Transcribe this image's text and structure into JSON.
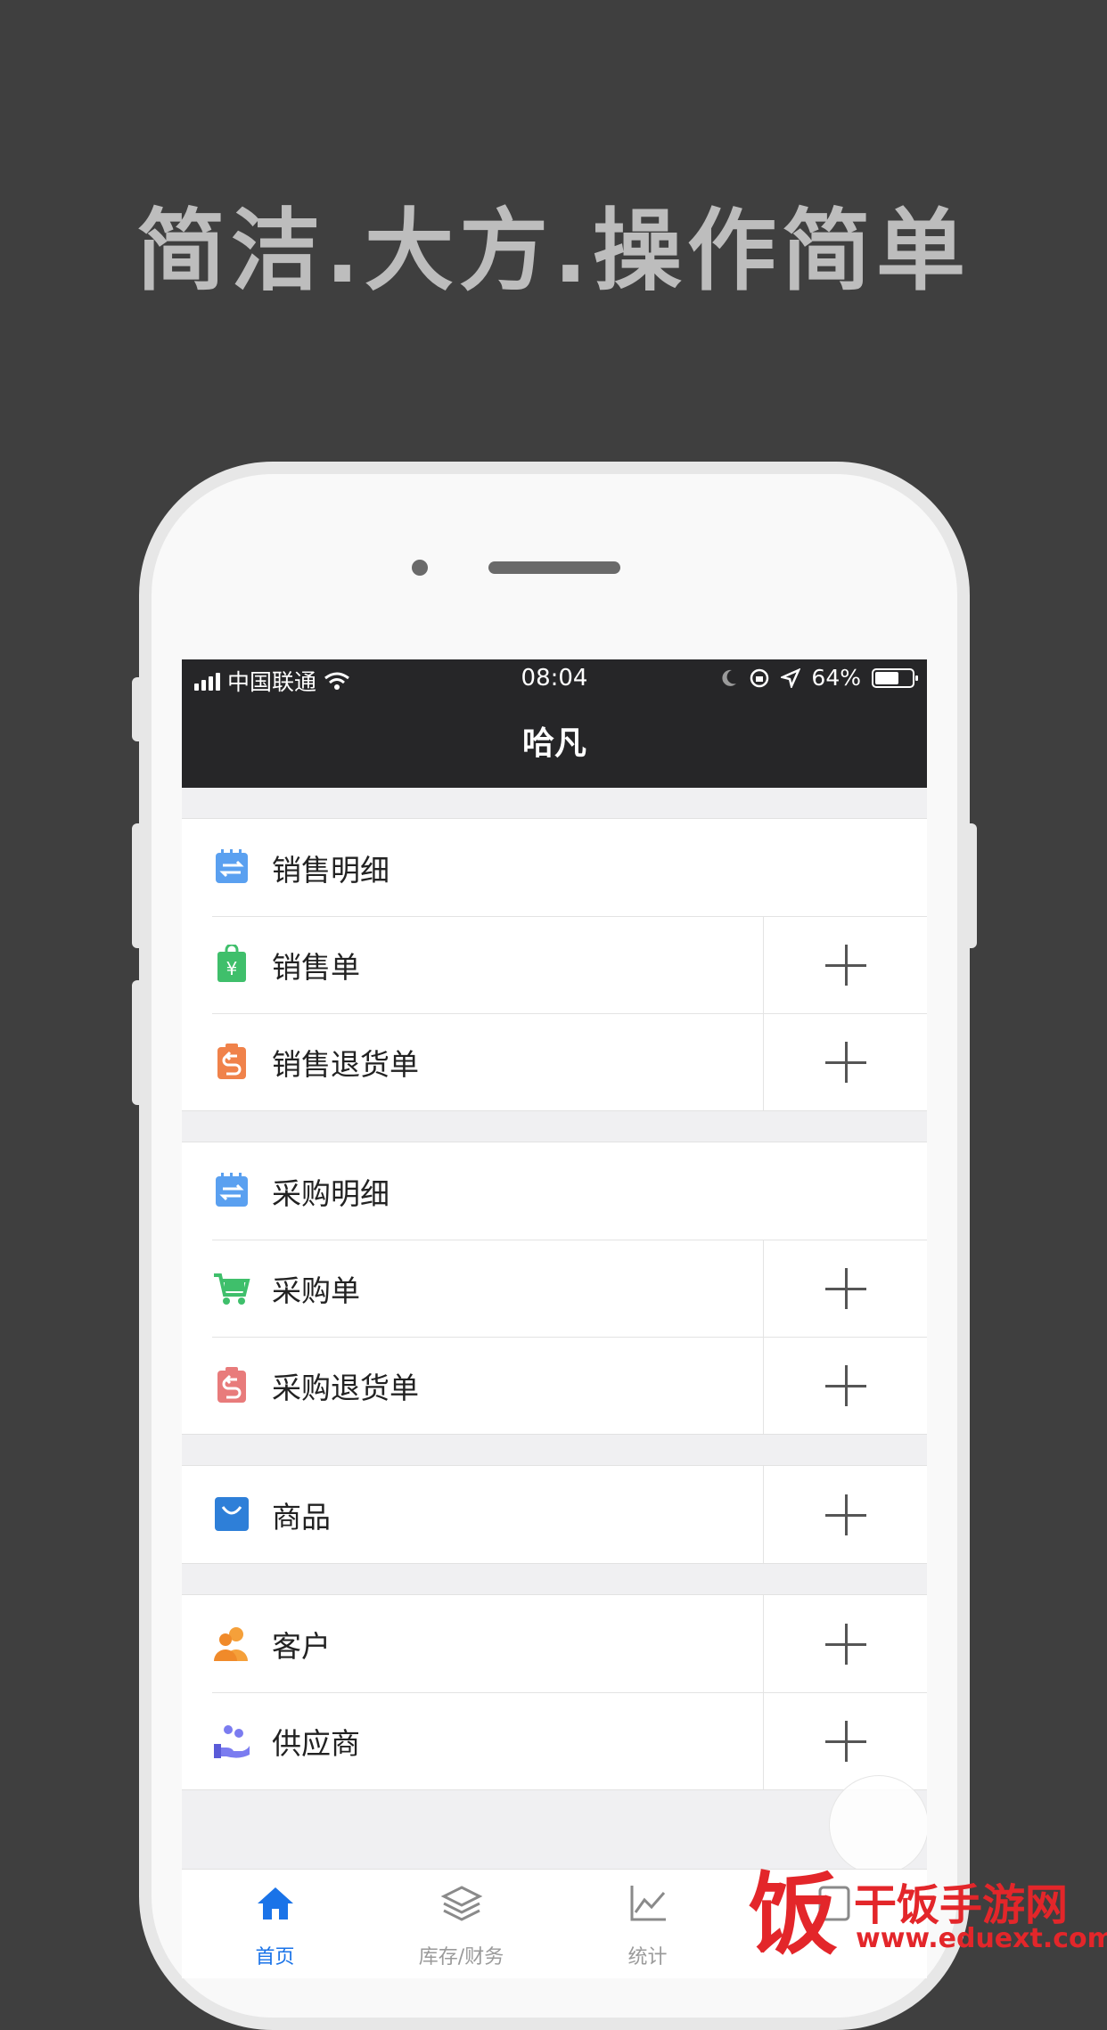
{
  "headline": "简洁.大方.操作简单",
  "status": {
    "carrier": "中国联通",
    "time": "08:04",
    "battery": "64%"
  },
  "nav": {
    "title": "哈凡"
  },
  "groups": [
    {
      "rows": [
        {
          "label": "销售明细",
          "icon": "sales-detail-icon",
          "add": false
        },
        {
          "label": "销售单",
          "icon": "sales-order-icon",
          "add": true
        },
        {
          "label": "销售退货单",
          "icon": "sales-return-icon",
          "add": true
        }
      ]
    },
    {
      "rows": [
        {
          "label": "采购明细",
          "icon": "purchase-detail-icon",
          "add": false
        },
        {
          "label": "采购单",
          "icon": "cart-icon",
          "add": true
        },
        {
          "label": "采购退货单",
          "icon": "purchase-return-icon",
          "add": true
        }
      ]
    },
    {
      "rows": [
        {
          "label": "商品",
          "icon": "shopping-bag-icon",
          "add": true
        }
      ]
    },
    {
      "rows": [
        {
          "label": "客户",
          "icon": "customers-icon",
          "add": true
        },
        {
          "label": "供应商",
          "icon": "supplier-icon",
          "add": true
        }
      ]
    }
  ],
  "tabs": [
    {
      "label": "首页",
      "icon": "home-icon",
      "active": true
    },
    {
      "label": "库存/财务",
      "icon": "layers-icon",
      "active": false
    },
    {
      "label": "统计",
      "icon": "chart-icon",
      "active": false
    },
    {
      "label": "",
      "icon": "settings-icon",
      "active": false
    }
  ],
  "watermark": {
    "glyph": "饭",
    "name": "干饭手游网",
    "url": "www.eduext.com"
  },
  "colors": {
    "background": "#3f3f3f",
    "navbar": "#262628",
    "active_tab": "#1a73e8",
    "watermark": "#e3262a"
  }
}
